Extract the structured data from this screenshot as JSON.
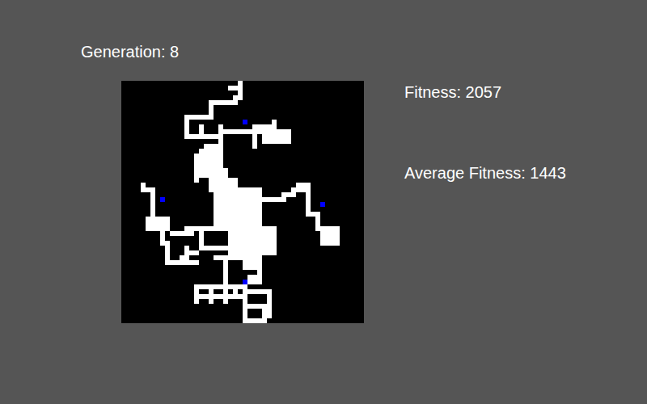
{
  "generation": {
    "label": "Generation: 8"
  },
  "stats": [
    {
      "label": "Fitness: 2057"
    },
    {
      "label": "Average Fitness: 1443"
    }
  ],
  "board": {
    "cols": 50,
    "rows": 50,
    "segments": [
      [
        24,
        0,
        1,
        4
      ],
      [
        22,
        1,
        3,
        1
      ],
      [
        23,
        3,
        1,
        1
      ],
      [
        18,
        4,
        6,
        1
      ],
      [
        18,
        4,
        1,
        3
      ],
      [
        13,
        7,
        6,
        1
      ],
      [
        13,
        7,
        1,
        5
      ],
      [
        13,
        11,
        8,
        1
      ],
      [
        16,
        9,
        1,
        3
      ],
      [
        20,
        9,
        1,
        3
      ],
      [
        21,
        10,
        12,
        1
      ],
      [
        28,
        9,
        3,
        1
      ],
      [
        27,
        9,
        1,
        5
      ],
      [
        29,
        10,
        6,
        3
      ],
      [
        31,
        8,
        1,
        2
      ],
      [
        20,
        12,
        1,
        6
      ],
      [
        17,
        13,
        3,
        1
      ],
      [
        15,
        15,
        1,
        6
      ],
      [
        15,
        18,
        4,
        1
      ],
      [
        16,
        14,
        4,
        6
      ],
      [
        18,
        18,
        4,
        5
      ],
      [
        19,
        22,
        10,
        9
      ],
      [
        20,
        20,
        4,
        3
      ],
      [
        22,
        30,
        10,
        6
      ],
      [
        25,
        33,
        6,
        1
      ],
      [
        21,
        36,
        1,
        4
      ],
      [
        25,
        36,
        4,
        3
      ],
      [
        28,
        30,
        1,
        10
      ],
      [
        19,
        36,
        9,
        1
      ],
      [
        26,
        40,
        3,
        2
      ],
      [
        29,
        24,
        5,
        1
      ],
      [
        33,
        23,
        3,
        1
      ],
      [
        35,
        22,
        4,
        1
      ],
      [
        36,
        21,
        3,
        1
      ],
      [
        38,
        22,
        1,
        5
      ],
      [
        38,
        27,
        3,
        1
      ],
      [
        40,
        27,
        1,
        4
      ],
      [
        41,
        30,
        4,
        4
      ],
      [
        44,
        32,
        1,
        2
      ],
      [
        4,
        21,
        1,
        2
      ],
      [
        4,
        22,
        3,
        1
      ],
      [
        6,
        22,
        1,
        7
      ],
      [
        5,
        28,
        3,
        1
      ],
      [
        5,
        28,
        5,
        3
      ],
      [
        8,
        30,
        1,
        4
      ],
      [
        9,
        33,
        1,
        5
      ],
      [
        10,
        37,
        6,
        1
      ],
      [
        12,
        36,
        1,
        2
      ],
      [
        13,
        34,
        1,
        3
      ],
      [
        14,
        35,
        2,
        1
      ],
      [
        10,
        31,
        5,
        1
      ],
      [
        13,
        30,
        1,
        2
      ],
      [
        13,
        30,
        6,
        1
      ],
      [
        16,
        31,
        1,
        4
      ],
      [
        17,
        34,
        5,
        1
      ],
      [
        21,
        39,
        1,
        3
      ],
      [
        15,
        42,
        11,
        1
      ],
      [
        15,
        44,
        11,
        1
      ],
      [
        15,
        42,
        1,
        4
      ],
      [
        18,
        42,
        1,
        4
      ],
      [
        21,
        42,
        1,
        4
      ],
      [
        23,
        42,
        1,
        3
      ],
      [
        25,
        41,
        1,
        6
      ],
      [
        25,
        46,
        6,
        1
      ],
      [
        25,
        43,
        6,
        1
      ],
      [
        30,
        43,
        1,
        6
      ],
      [
        25,
        47,
        1,
        3
      ],
      [
        25,
        49,
        5,
        1
      ],
      [
        29,
        46,
        1,
        4
      ]
    ],
    "markers": [
      {
        "x": 25,
        "y": 8,
        "color": "#0000ff"
      },
      {
        "x": 8,
        "y": 24,
        "color": "#0000ff"
      },
      {
        "x": 41,
        "y": 25,
        "color": "#0000ff"
      },
      {
        "x": 25,
        "y": 41,
        "color": "#0000ff"
      }
    ]
  }
}
